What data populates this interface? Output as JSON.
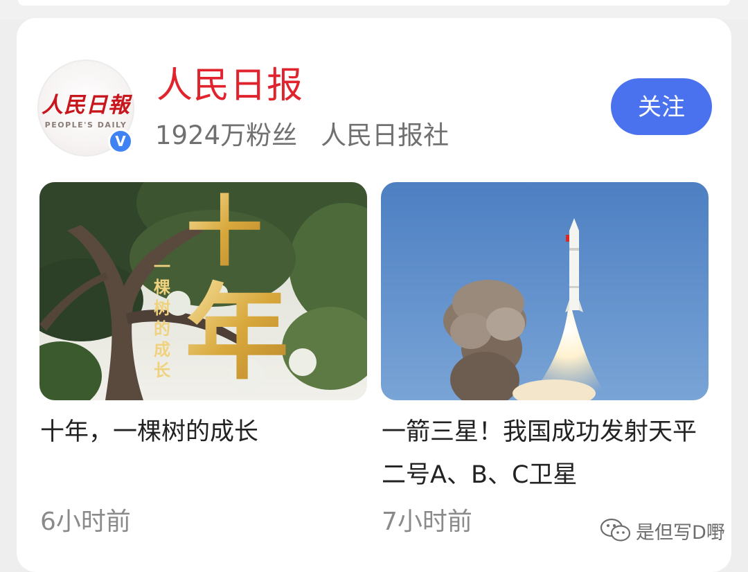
{
  "account": {
    "name": "人民日报",
    "followers": "1924万粉丝",
    "organization": "人民日报社",
    "avatar_logo_cn": "人民日報",
    "avatar_logo_en": "PEOPLE'S DAILY",
    "verified_badge": "V",
    "follow_label": "关注",
    "brand_color": "#e0232d",
    "button_color": "#4a72ee",
    "badge_color": "#3e82f4"
  },
  "articles": [
    {
      "title": "十年，一棵树的成长",
      "time": "6小时前",
      "thumb_big_text": "十年",
      "thumb_vertical_text": "一棵树的成长",
      "thumb_icon": "tree-photo"
    },
    {
      "title": "一箭三星！我国成功发射天平二号A、B、C卫星",
      "time": "7小时前",
      "thumb_icon": "rocket-launch-photo"
    }
  ],
  "watermark": {
    "text": "是但写D嘢",
    "icon": "wechat-icon"
  }
}
